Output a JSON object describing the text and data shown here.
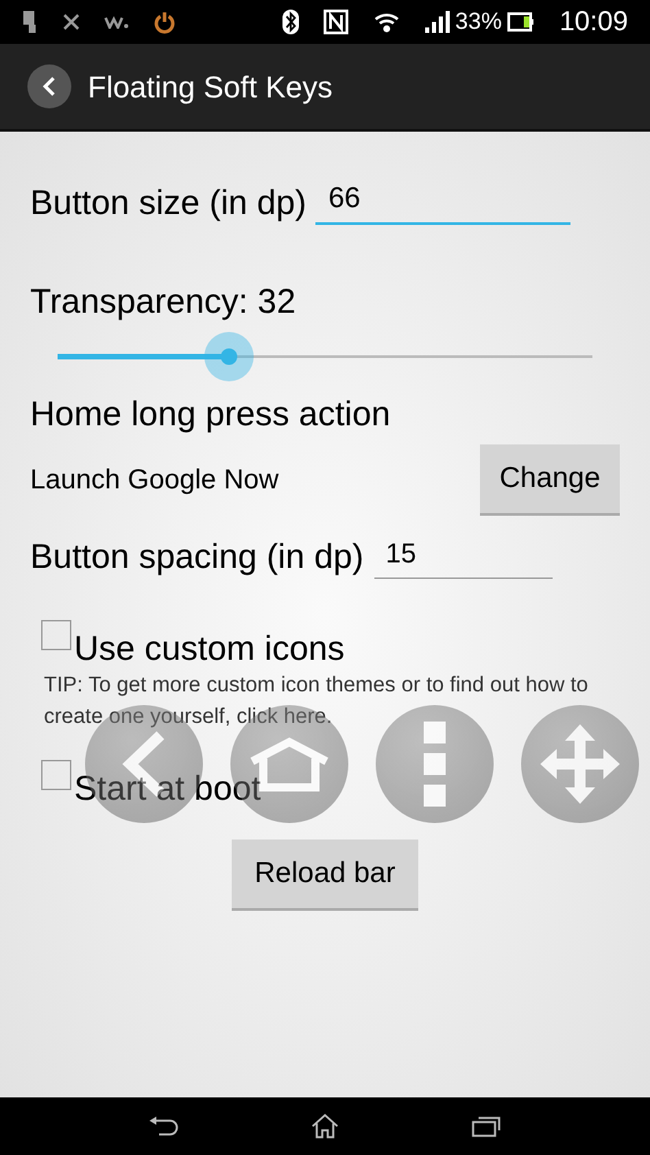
{
  "status_bar": {
    "battery": "33%",
    "time": "10:09"
  },
  "action_bar": {
    "title": "Floating Soft Keys"
  },
  "button_size": {
    "label": "Button size (in dp)",
    "value": "66"
  },
  "transparency": {
    "label": "Transparency: 32",
    "level": 0.32
  },
  "home_action": {
    "heading": "Home long press action",
    "value": "Launch Google Now",
    "button": "Change"
  },
  "button_spacing": {
    "label": "Button spacing (in dp)",
    "value": "15"
  },
  "custom_icons": {
    "label": "Use custom icons",
    "checked": false,
    "tip": "TIP: To get more custom icon themes or to find out how to create one yourself, click here."
  },
  "start_at_boot": {
    "label": "Start at boot",
    "checked": false
  },
  "reload_button": "Reload bar"
}
